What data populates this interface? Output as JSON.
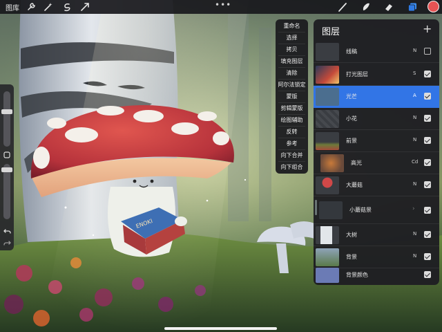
{
  "topbar": {
    "gallery_label": "图库",
    "tools_left": [
      "wrench-icon",
      "magic-wand-icon",
      "selection-icon",
      "transform-arrow-icon"
    ],
    "tools_right": [
      "brush-icon",
      "smudge-icon",
      "eraser-icon",
      "layers-icon"
    ],
    "more_label": "•••",
    "current_color": "#e65354"
  },
  "menu": {
    "items": [
      "重命名",
      "选择",
      "拷贝",
      "填充图层",
      "清除",
      "阿尔法锁定",
      "蒙版",
      "剪辑蒙版",
      "绘图辅助",
      "反转",
      "参考",
      "向下合并",
      "向下组合"
    ]
  },
  "layers": {
    "title": "图层",
    "add_label": "+",
    "rows": [
      {
        "name": "线稿",
        "blend": "N",
        "visible": false,
        "selected": false,
        "group": false
      },
      {
        "name": "打光图层",
        "blend": "S",
        "visible": true,
        "selected": false,
        "group": false
      },
      {
        "name": "光芒",
        "blend": "A",
        "visible": true,
        "selected": true,
        "group": false
      },
      {
        "name": "小花",
        "blend": "N",
        "visible": true,
        "selected": false,
        "group": false
      },
      {
        "name": "前景",
        "blend": "N",
        "visible": true,
        "selected": false,
        "group": false
      },
      {
        "name": "高光",
        "blend": "Cd",
        "visible": true,
        "selected": false,
        "group": false
      },
      {
        "name": "大蘑菇",
        "blend": "N",
        "visible": true,
        "selected": false,
        "group": false
      },
      {
        "name": "小蘑菇景",
        "blend": "",
        "visible": true,
        "selected": false,
        "group": true
      },
      {
        "name": "大树",
        "blend": "N",
        "visible": true,
        "selected": false,
        "group": false
      },
      {
        "name": "背景",
        "blend": "N",
        "visible": true,
        "selected": false,
        "group": false
      },
      {
        "name": "背景颜色",
        "blend": "",
        "visible": true,
        "selected": false,
        "group": false
      }
    ]
  },
  "sidebar": {
    "undo_icon": "undo-icon",
    "modify_icon": "square-modify-icon"
  },
  "colors": {
    "accent": "#3275e6",
    "mushroom_cap": "#c8373d",
    "background_color_swatch": "#6b7bb5"
  }
}
